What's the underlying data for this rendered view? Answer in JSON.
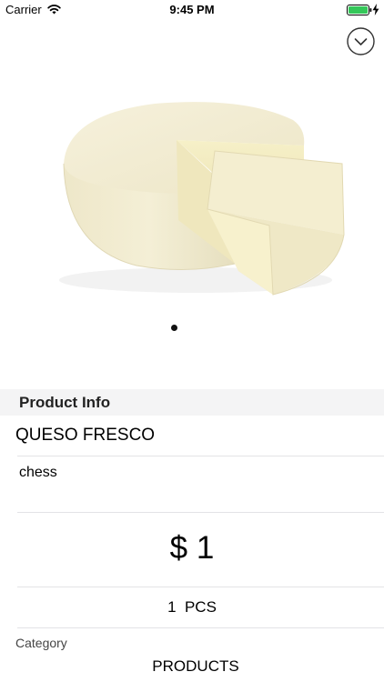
{
  "status_bar": {
    "carrier": "Carrier",
    "time": "9:45 PM",
    "icons": [
      "wifi-icon",
      "battery-icon",
      "charging-icon"
    ],
    "battery_color": "#34c759"
  },
  "header": {
    "dismiss_icon": "chevron-down-circle-icon"
  },
  "gallery": {
    "image": "cheese-wheel-image",
    "page_count": 1,
    "current_page": 1
  },
  "product": {
    "section_title": "Product Info",
    "name": "QUESO FRESCO",
    "description": "chess",
    "price": "$ 1",
    "quantity": "1  PCS",
    "category_label": "Category",
    "category_value": "PRODUCTS"
  }
}
